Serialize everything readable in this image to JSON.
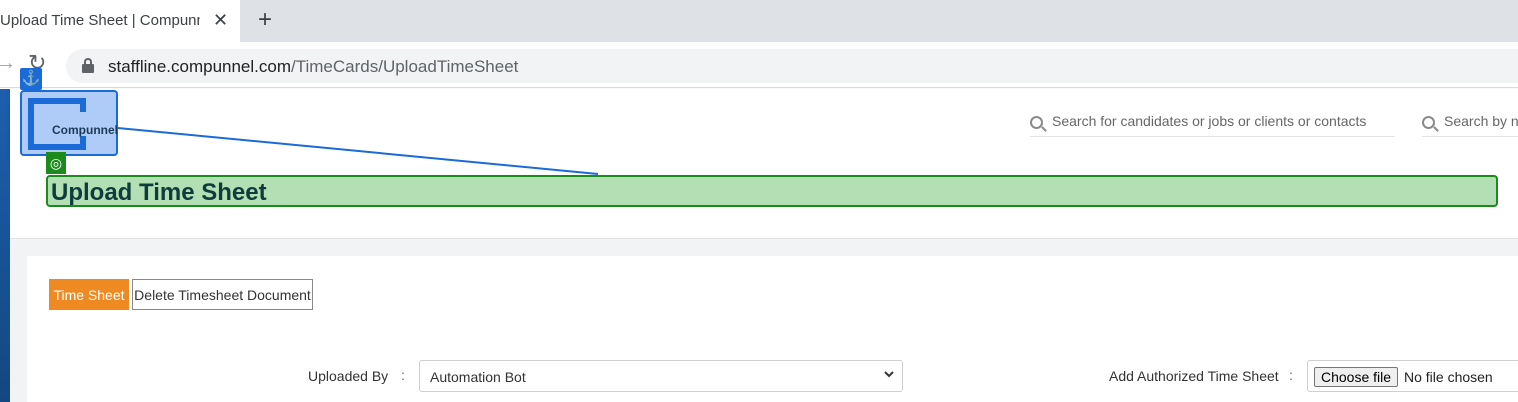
{
  "browser": {
    "tab_title": "Upload Time Sheet | Compunnel",
    "tab_close": "✕",
    "new_tab": "+",
    "url_domain": "staffline.compunnel.com",
    "url_path": "/TimeCards/UploadTimeSheet"
  },
  "header": {
    "logo_text": "Compunnel",
    "search_placeholder": "Search for candidates or jobs or clients or contacts",
    "search2_placeholder": "Search by n"
  },
  "page": {
    "title": "Upload Time Sheet"
  },
  "tabs": {
    "time_sheet": "Time Sheet",
    "delete_doc": "Delete Timesheet Document"
  },
  "form": {
    "uploaded_by_label": "Uploaded By",
    "colon": ":",
    "uploaded_by_value": "Automation Bot",
    "add_sheet_label": "Add Authorized Time Sheet",
    "choose_file": "Choose file",
    "no_file": "No file chosen"
  },
  "overlay": {
    "anchor_glyph": "⚓",
    "target_glyph": "◎"
  },
  "colors": {
    "accent_orange": "#ef8a22",
    "anchor_blue": "#1a6ad8",
    "target_green": "#1d8a1d"
  }
}
